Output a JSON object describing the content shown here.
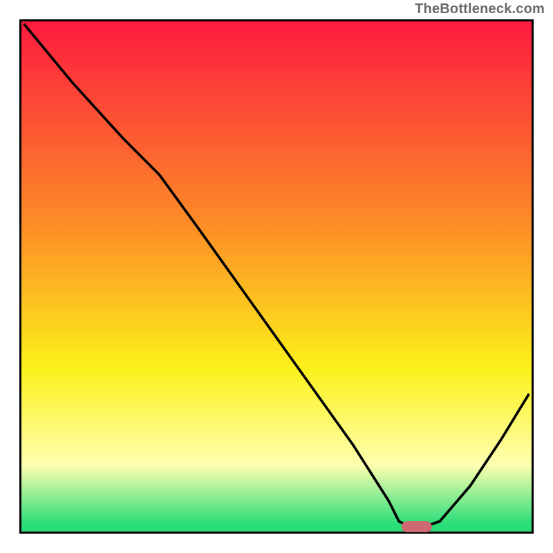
{
  "attribution": "TheBottleneck.com",
  "colors": {
    "red": "#fc1b3f",
    "orange": "#fc8d27",
    "yellow": "#fcf11b",
    "pale_yellow": "#feffb0",
    "green": "#2bdd79",
    "curve": "#000000",
    "marker": "#cf6a72",
    "frame": "#000000"
  },
  "chart_data": {
    "type": "line",
    "title": "",
    "xlabel": "",
    "ylabel": "",
    "xlim": [
      0,
      100
    ],
    "ylim": [
      0,
      100
    ],
    "series": [
      {
        "name": "bottleneck-curve",
        "x": [
          0.5,
          10,
          20,
          27,
          35,
          45,
          55,
          65,
          72,
          74,
          76,
          79,
          82,
          88,
          94,
          99.5
        ],
        "y": [
          99.5,
          88,
          77,
          70,
          59,
          45,
          31,
          17,
          6,
          2,
          1,
          1,
          2,
          9,
          18,
          27
        ]
      }
    ],
    "optimum_marker": {
      "x": 77.5,
      "y": 1,
      "width_pct": 6
    },
    "gradient_stops": [
      {
        "offset": 0.0,
        "color": "#fc1b3f"
      },
      {
        "offset": 0.4,
        "color": "#fc8d27"
      },
      {
        "offset": 0.68,
        "color": "#fcf11b"
      },
      {
        "offset": 0.87,
        "color": "#feffb0"
      },
      {
        "offset": 0.985,
        "color": "#2bdd79"
      }
    ]
  }
}
